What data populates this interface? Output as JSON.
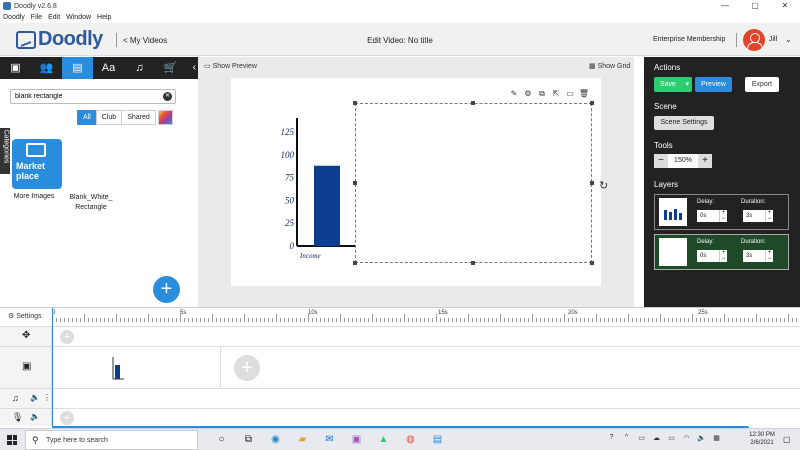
{
  "window": {
    "title": "Doodly v2.6.8",
    "minimize": "—",
    "maximize": "▢",
    "close": "✕"
  },
  "menu": [
    "Doodly",
    "File",
    "Edit",
    "Window",
    "Help"
  ],
  "header": {
    "logo": "Doodly",
    "my_videos": "< My Videos",
    "video_title": "Edit Video: No title",
    "membership": "Enterprise Membership",
    "user": "Jill",
    "chevron": "⌄"
  },
  "left_panel": {
    "tabs": [
      {
        "name": "images",
        "icon": "image-icon",
        "glyph": "▣"
      },
      {
        "name": "characters",
        "icon": "people-icon",
        "glyph": "👥"
      },
      {
        "name": "props",
        "icon": "props-icon",
        "glyph": "▤"
      },
      {
        "name": "text",
        "icon": "text-icon",
        "glyph": "Aa"
      },
      {
        "name": "music",
        "icon": "music-icon",
        "glyph": "♫"
      },
      {
        "name": "marketplace",
        "icon": "cart-icon",
        "glyph": "🛒"
      }
    ],
    "collapse": "‹",
    "search": {
      "value": "blank rectangle",
      "placeholder": "Search",
      "clear": "✕"
    },
    "filters": [
      "All",
      "Club",
      "Shared"
    ],
    "categories": "Categories",
    "marketplace_tile": "Market place",
    "items": [
      "More Images",
      "Blank_White_ Rectangle"
    ],
    "fab": "+"
  },
  "canvas": {
    "show_preview": "Show Preview",
    "show_grid": "Show Grid",
    "tools": [
      "✎",
      "⚙",
      "⧉",
      "⇱",
      "▭",
      "🗑"
    ],
    "rotate": "↻"
  },
  "chart_data": {
    "type": "bar",
    "categories": [
      "Income"
    ],
    "values": [
      88
    ],
    "ylim": [
      0,
      125
    ],
    "yticks": [
      0,
      25,
      50,
      75,
      100,
      125
    ],
    "xlabel": "Income",
    "bar_color": "#0b3d91"
  },
  "right_panel": {
    "actions_label": "Actions",
    "save": "Save",
    "preview": "Preview",
    "export": "Export",
    "scene_label": "Scene",
    "scene_settings": "Scene Settings",
    "tools_label": "Tools",
    "zoom_minus": "−",
    "zoom_value": "150%",
    "zoom_plus": "+",
    "layers_label": "Layers",
    "layers": [
      {
        "delay_label": "Delay:",
        "delay": "0s",
        "duration_label": "Duration:",
        "duration": "3s"
      },
      {
        "delay_label": "Delay:",
        "delay": "0s",
        "duration_label": "Duration:",
        "duration": "3s"
      }
    ]
  },
  "timeline": {
    "settings": "Settings",
    "marks": [
      "0",
      "5s",
      "10s",
      "15s",
      "20s",
      "25s"
    ],
    "add": "+"
  },
  "taskbar": {
    "search_text": "Type here to search",
    "time": "12:30 PM",
    "date": "2/6/2021"
  },
  "colors": {
    "accent": "#2a8cdd",
    "save_green": "#2ecc71",
    "panel_dark": "#222222",
    "avatar_red": "#e0452c"
  }
}
